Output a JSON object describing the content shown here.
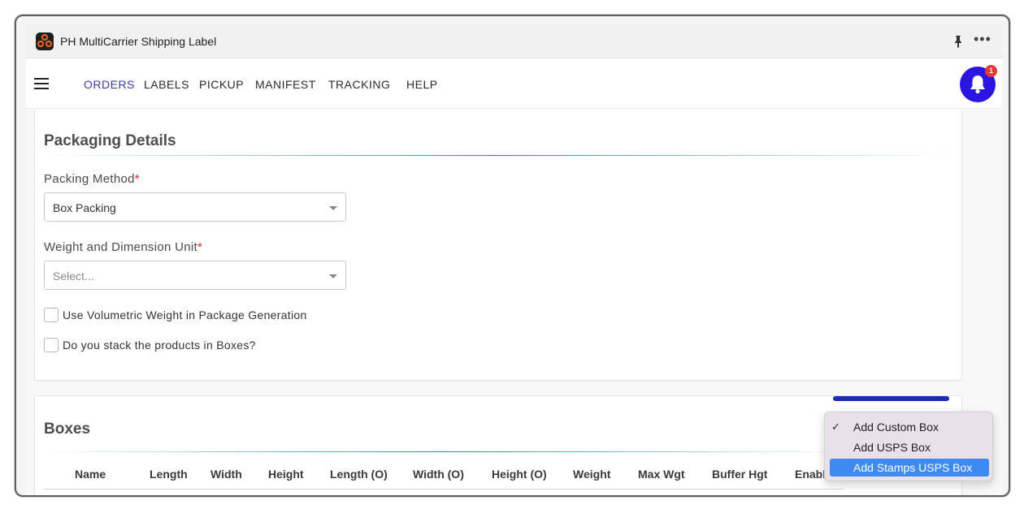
{
  "window": {
    "title": "PH MultiCarrier Shipping Label"
  },
  "nav": {
    "items": [
      "ORDERS",
      "LABELS",
      "PICKUP",
      "MANIFEST",
      "TRACKING",
      "HELP"
    ],
    "active": "ORDERS",
    "notification_count": "1"
  },
  "packaging": {
    "title": "Packaging Details",
    "packing_method": {
      "label": "Packing Method",
      "required": "*",
      "value": "Box Packing"
    },
    "unit": {
      "label": "Weight and Dimension Unit",
      "required": "*",
      "placeholder": "Select..."
    },
    "checkboxes": [
      {
        "label": "Use Volumetric Weight in Package Generation",
        "checked": false
      },
      {
        "label": "Do you stack the products in Boxes?",
        "checked": false
      }
    ]
  },
  "boxes": {
    "title": "Boxes",
    "columns": [
      "Name",
      "Length",
      "Width",
      "Height",
      "Length (O)",
      "Width (O)",
      "Height (O)",
      "Weight",
      "Max Wgt",
      "Buffer Hgt",
      "Enabl"
    ]
  },
  "menu": {
    "items": [
      {
        "label": "Add Custom Box",
        "checked": true,
        "highlighted": false
      },
      {
        "label": "Add USPS Box",
        "checked": false,
        "highlighted": false
      },
      {
        "label": "Add Stamps USPS Box",
        "checked": false,
        "highlighted": true
      }
    ],
    "check_glyph": "✓"
  },
  "colors": {
    "accent": "#2a16e0",
    "nav_active": "#3b3ba8",
    "required": "#e0262b",
    "menu_highlight": "#3d8bf2"
  }
}
